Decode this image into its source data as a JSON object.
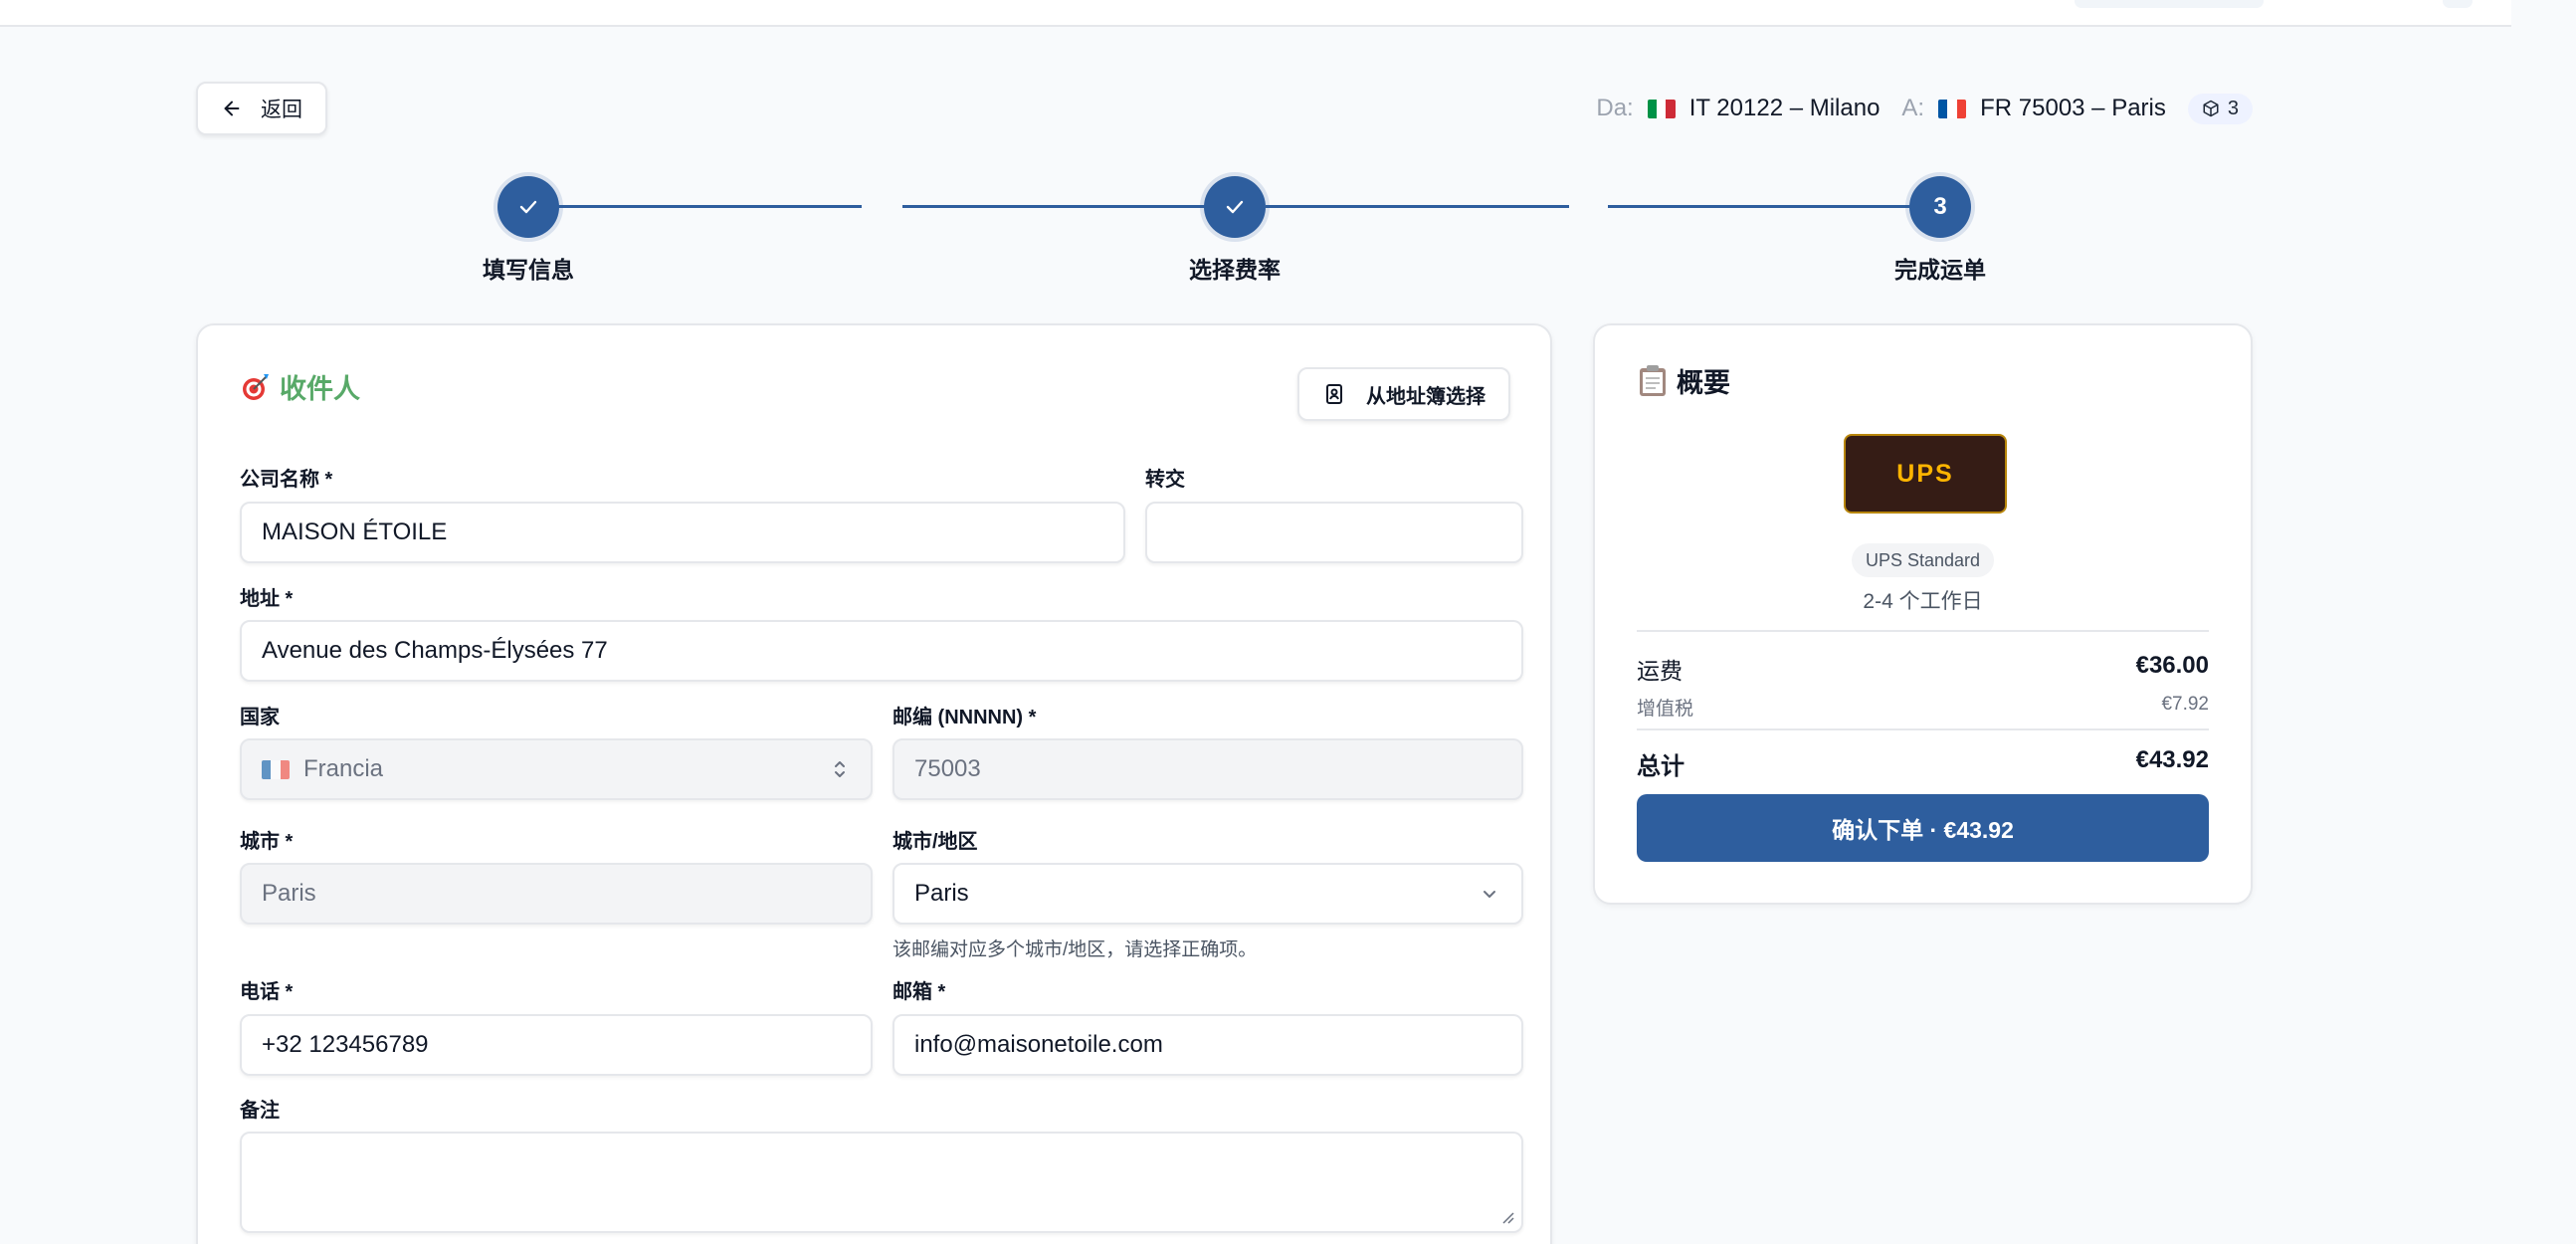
{
  "header": {
    "back_label": "返回",
    "from_label": "Da:",
    "from_value": "IT 20122 – Milano",
    "to_label": "A:",
    "to_value": "FR 75003 – Paris",
    "package_count": "3"
  },
  "stepper": {
    "steps": [
      {
        "label": "填写信息",
        "state": "done"
      },
      {
        "label": "选择费率",
        "state": "done"
      },
      {
        "label": "完成运单",
        "number": "3",
        "state": "active"
      }
    ]
  },
  "recipient": {
    "title": "收件人",
    "title_icon": "target-emoji",
    "address_book_button": "从地址簿选择",
    "company_label": "公司名称 *",
    "company_value": "MAISON ÉTOILE",
    "attn_label": "转交",
    "attn_value": "",
    "address_label": "地址 *",
    "address_value": "Avenue des Champs-Élysées 77",
    "country_label": "国家",
    "country_value": "Francia",
    "zip_label": "邮编 (NNNNN) *",
    "zip_value": "75003",
    "city_label": "城市 *",
    "city_value": "Paris",
    "district_label": "城市/地区",
    "district_value": "Paris",
    "district_hint": "该邮编对应多个城市/地区，请选择正确项。",
    "phone_label": "电话 *",
    "phone_value": "+32 123456789",
    "email_label": "邮箱 *",
    "email_value": "info@maisonetoile.com",
    "notes_label": "备注",
    "notes_value": ""
  },
  "summary": {
    "title": "概要",
    "title_icon": "clipboard-emoji",
    "carrier_logo_text": "UPS",
    "service_name": "UPS Standard",
    "transit_time": "2-4 个工作日",
    "shipping_label": "运费",
    "shipping_value": "€36.00",
    "vat_label": "增值税",
    "vat_value": "€7.92",
    "total_label": "总计",
    "total_value": "€43.92",
    "confirm_button": "确认下单 · €43.92"
  },
  "colors": {
    "primary": "#2e5e9e",
    "recipient_title": "#58a968",
    "ups_brown": "#351c15",
    "ups_gold": "#ffb500"
  }
}
